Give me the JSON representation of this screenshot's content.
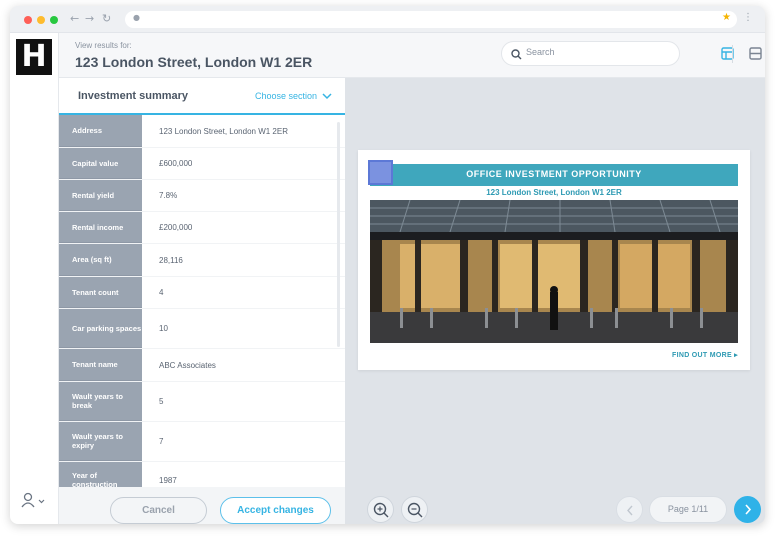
{
  "header": {
    "subtitle": "View results for:",
    "title": "123 London Street, London W1 2ER",
    "search_placeholder": "Search"
  },
  "section": {
    "title": "Investment summary",
    "choose_label": "Choose section"
  },
  "rows": [
    {
      "label": "Address",
      "value": "123 London Street, London W1 2ER"
    },
    {
      "label": "Capital value",
      "value": "£600,000"
    },
    {
      "label": "Rental yield",
      "value": "7.8%"
    },
    {
      "label": "Rental income",
      "value": "£200,000"
    },
    {
      "label": "Area (sq ft)",
      "value": "28,116"
    },
    {
      "label": "Tenant count",
      "value": "4"
    },
    {
      "label": "Car parking spaces",
      "value": "10"
    },
    {
      "label": "Tenant name",
      "value": "ABC Associates"
    },
    {
      "label": "Wault years to break",
      "value": "5"
    },
    {
      "label": "Wault years to expiry",
      "value": "7"
    },
    {
      "label": "Year of construction",
      "value": "1987"
    }
  ],
  "footer": {
    "cancel_label": "Cancel",
    "accept_label": "Accept changes"
  },
  "document": {
    "banner": "OFFICE INVESTMENT OPPORTUNITY",
    "subtitle": "123 London Street, London W1 2ER",
    "find_more": "FIND OUT MORE ▸"
  },
  "pager": {
    "label": "Page 1/11"
  },
  "logo_letter": "H",
  "colors": {
    "accent": "#36b4e3",
    "label_bg": "#9aa4b1",
    "banner": "#3fa7bd"
  },
  "icons": [
    "search-icon",
    "layout-icon",
    "split-icon",
    "chevron-down-icon",
    "user-icon",
    "zoom-in-icon",
    "zoom-out-icon",
    "chevron-left-icon",
    "chevron-right-icon"
  ]
}
